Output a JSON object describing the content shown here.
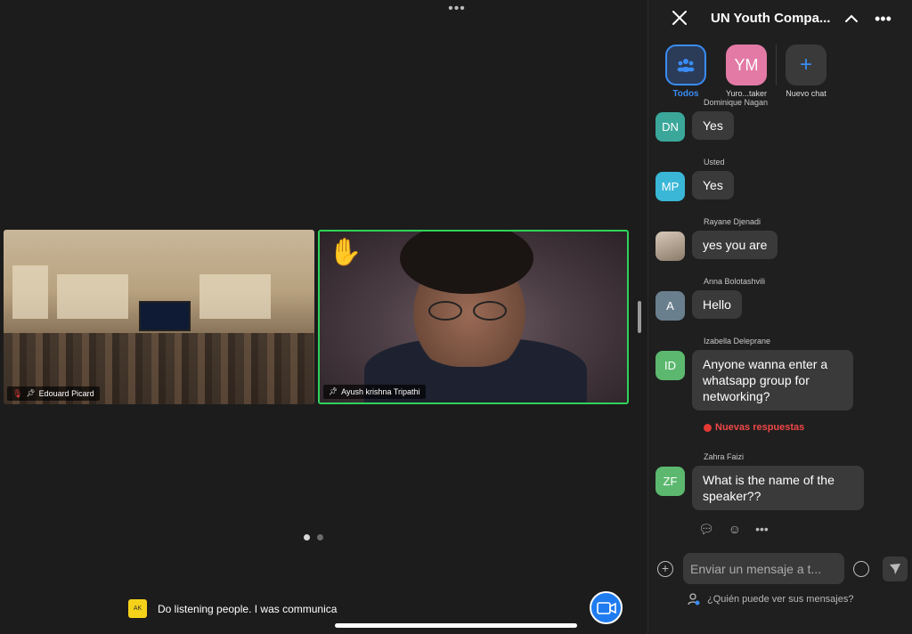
{
  "top_more_dots": "•••",
  "participants": [
    {
      "name": "Edouard Picard",
      "muted": true,
      "pinned": true
    },
    {
      "name": "Ayush krishna Tripathi",
      "raised_hand": true,
      "pinned": true,
      "active_speaker": true
    }
  ],
  "page_indicator": {
    "pages": 2,
    "current": 1
  },
  "caption": {
    "avatar_initials": "AK",
    "text": "Do listening people. I was communica"
  },
  "chat": {
    "title": "UN Youth Compa...",
    "recipients": [
      {
        "label": "Todos",
        "icon": "people-icon",
        "selected": true
      },
      {
        "label": "Yuro...taker",
        "initials": "YM",
        "color": "#e37aa5"
      },
      {
        "label": "Nuevo chat",
        "icon": "plus-icon"
      }
    ],
    "messages": [
      {
        "sender": "Dominique Nagan",
        "initials": "DN",
        "avatar_color": "#3aa79a",
        "text": "Yes"
      },
      {
        "sender": "Usted",
        "initials": "MP",
        "avatar_color": "#3ab7d6",
        "text": "Yes"
      },
      {
        "sender": "Rayane Djenadi",
        "initials": "",
        "avatar_type": "photo",
        "text": "yes you are"
      },
      {
        "sender": "Anna Bolotashvili",
        "initials": "A",
        "avatar_color": "#6a7f8e",
        "text": "Hello"
      },
      {
        "sender": "Izabella Deleprane",
        "initials": "ID",
        "avatar_color": "#5cb86f",
        "text": "Anyone wanna enter a whatsapp group for networking?"
      },
      {
        "sender": "Zahra Faizi",
        "initials": "ZF",
        "avatar_color": "#5cb86f",
        "text": "What is the name of the speaker??"
      }
    ],
    "new_replies": "Nuevas respuestas",
    "composer": {
      "placeholder": "Enviar un mensaje a t..."
    },
    "privacy_text": "¿Quién puede ver sus mensajes?"
  },
  "colors": {
    "accent": "#1f7cf0",
    "active_speaker_border": "#2fd35a",
    "new_replies": "#ef4747"
  }
}
